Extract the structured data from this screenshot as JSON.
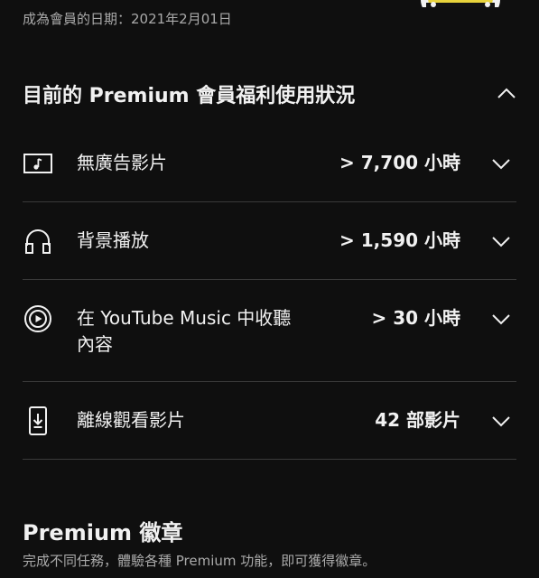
{
  "membership": {
    "since_text": "成為會員的日期：2021年2月01日"
  },
  "benefits_section": {
    "title": "目前的 Premium 會員福利使用狀況",
    "expanded": true,
    "items": [
      {
        "icon": "music-video-icon",
        "label": "無廣告影片",
        "value": "> 7,700 小時"
      },
      {
        "icon": "headphones-icon",
        "label": "背景播放",
        "value": "> 1,590 小時"
      },
      {
        "icon": "youtube-music-icon",
        "label_line1": "在 YouTube Music 中收聽",
        "label_line2": "內容",
        "value": "> 30 小時"
      },
      {
        "icon": "download-icon",
        "label": "離線觀看影片",
        "value": "42 部影片"
      }
    ]
  },
  "badges": {
    "title": "Premium 徽章",
    "description": "完成不同任務，體驗各種 Premium 功能，即可獲得徽章。"
  },
  "colors": {
    "background": "#0f0f0f",
    "text_primary": "#f1f1f1",
    "text_secondary": "#aaaaaa",
    "divider": "#3a3a3a",
    "badge_accent": "#e8d33c"
  }
}
